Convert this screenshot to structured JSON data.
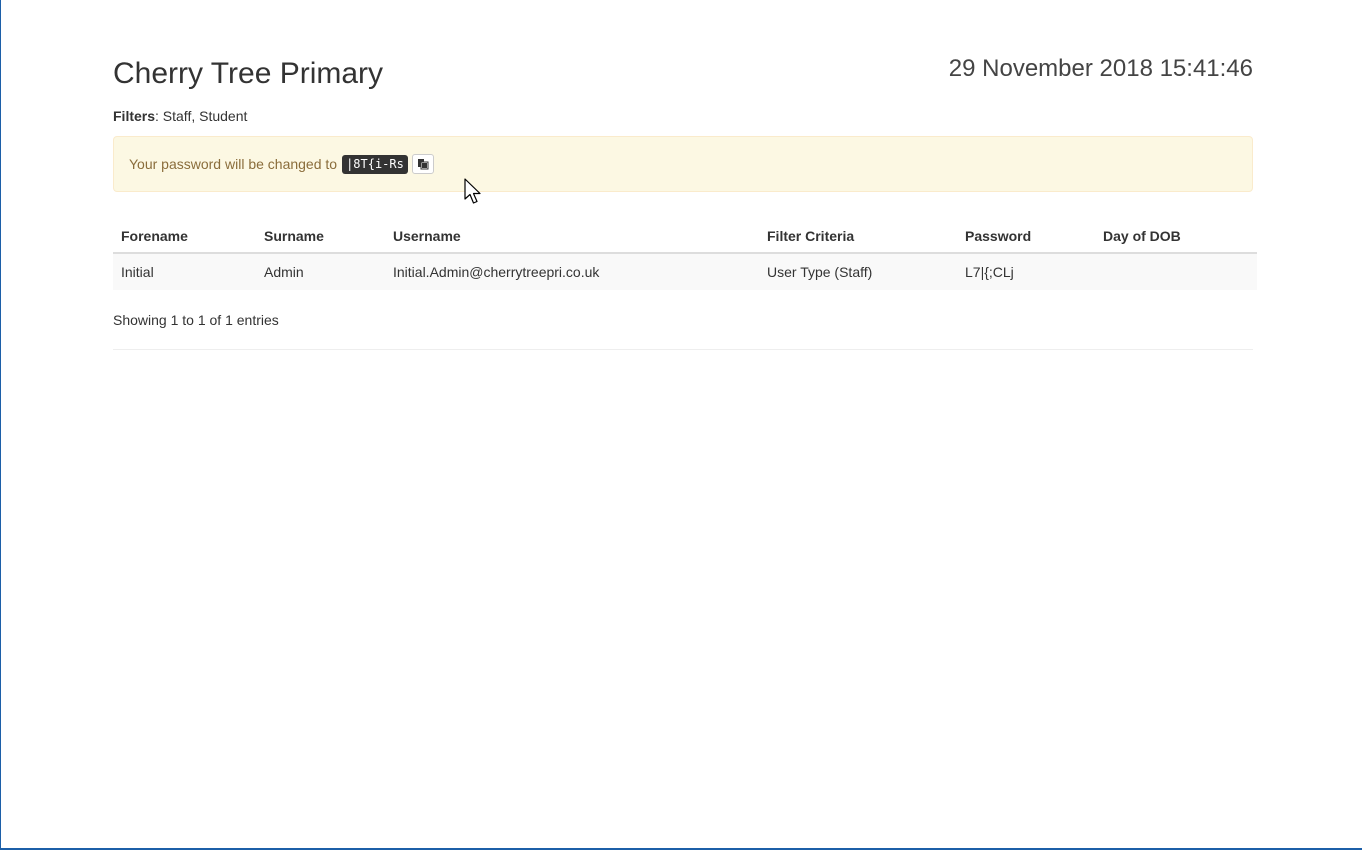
{
  "header": {
    "title": "Cherry Tree Primary",
    "timestamp": "29 November 2018 15:41:46"
  },
  "filters": {
    "label": "Filters",
    "separator": ":",
    "value": " Staff, Student"
  },
  "alert": {
    "message": "Your password will be changed to",
    "new_password": "|8T{i-Rs",
    "copy_icon": "clipboard-icon"
  },
  "table": {
    "columns": [
      "Forename",
      "Surname",
      "Username",
      "Filter Criteria",
      "Password",
      "Day of DOB"
    ],
    "rows": [
      [
        "Initial",
        "Admin",
        "Initial.Admin@cherrytreepri.co.uk",
        "User Type (Staff)",
        "L7|{;CLj",
        ""
      ]
    ]
  },
  "footer": {
    "info": "Showing 1 to 1 of 1 entries"
  },
  "colors": {
    "alert_background": "#fcf8e3",
    "alert_text": "#8a6d3b",
    "window_border": "#1c5fa8"
  }
}
